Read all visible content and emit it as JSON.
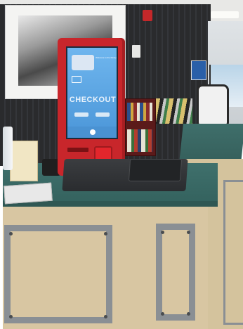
{
  "scene": {
    "kiosk_screen": {
      "heading": "CHECKOUT",
      "card_prompt": "Welcome to the library"
    },
    "colors": {
      "wall": "#2b2c2e",
      "ceiling": "#e9e9e7",
      "counter_top": "#3f6f6b",
      "counter_front": "#d8c6a2",
      "kiosk_red": "#c8262b",
      "screen_blue": "#5aa7e3",
      "steel": "#8a8f94"
    },
    "icons": [
      "book-icon",
      "barcode-icon",
      "card-reader-icon"
    ]
  }
}
